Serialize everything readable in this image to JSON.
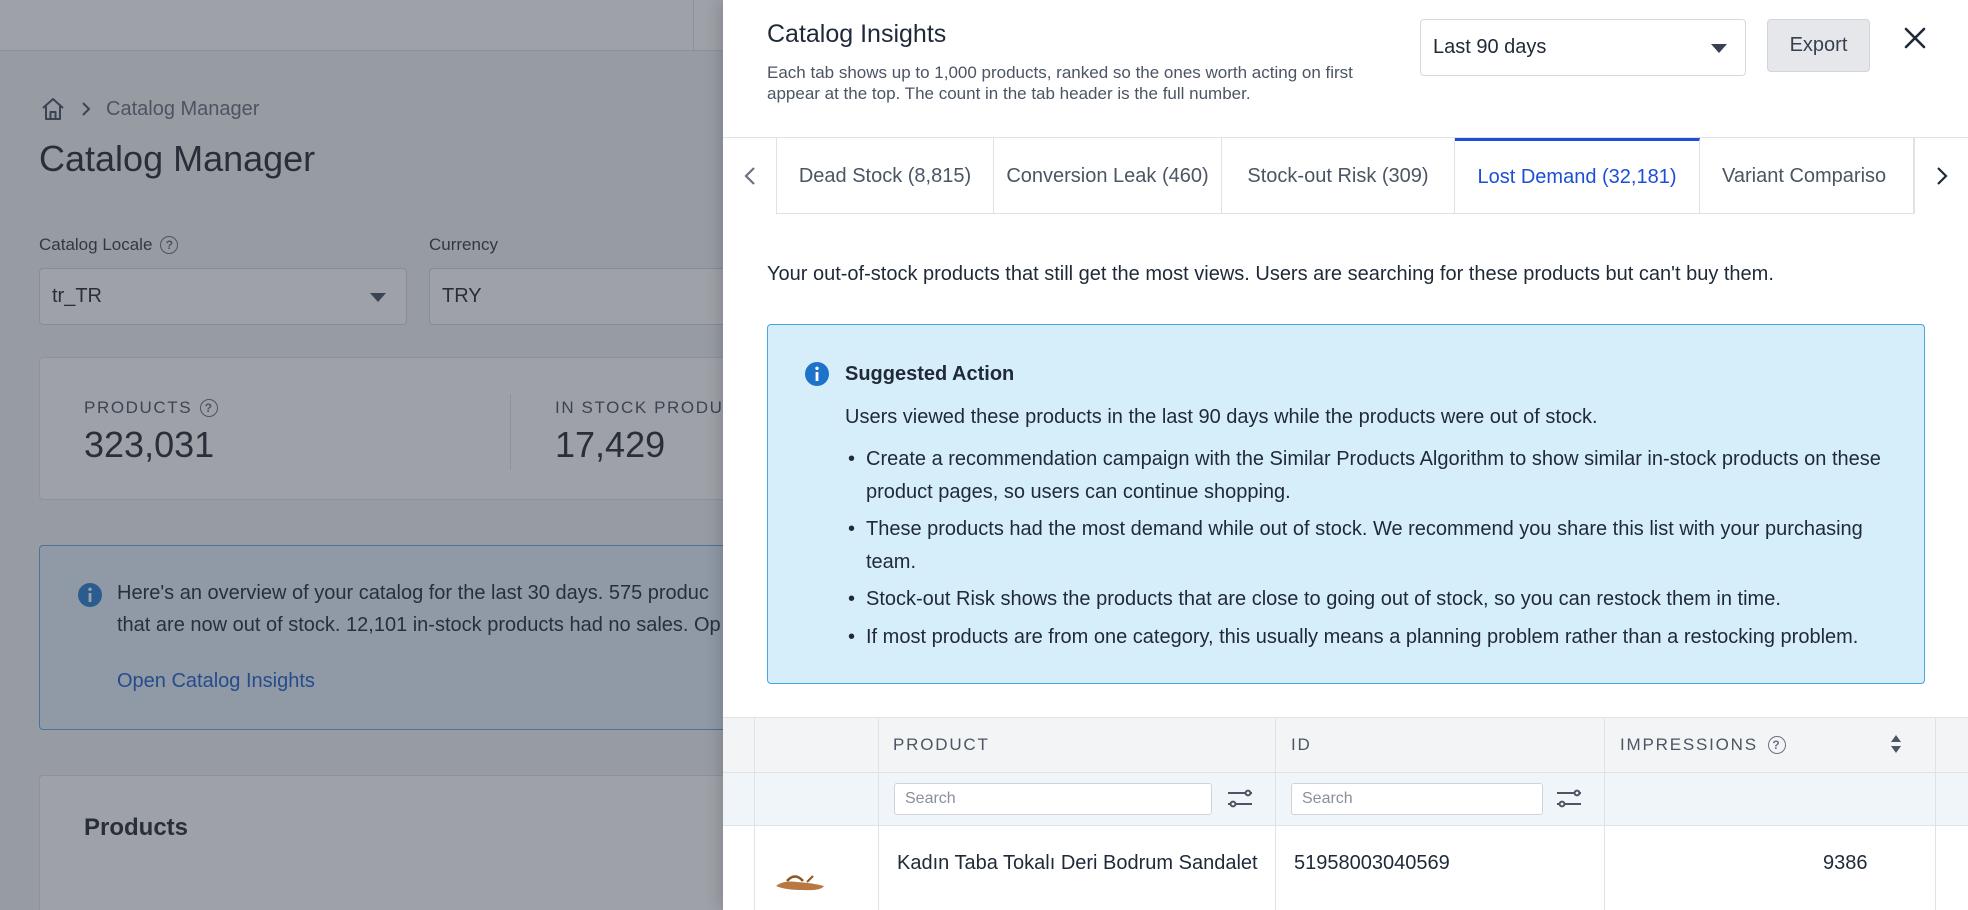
{
  "background": {
    "breadcrumb": {
      "current": "Catalog Manager"
    },
    "page_title": "Catalog Manager",
    "locale": {
      "label": "Catalog Locale",
      "value": "tr_TR"
    },
    "currency": {
      "label": "Currency",
      "value": "TRY"
    },
    "stats": [
      {
        "label": "PRODUCTS",
        "value": "323,031"
      },
      {
        "label": "IN STOCK PRODU",
        "value": "17,429"
      }
    ],
    "info": {
      "line1": "Here's an overview of your catalog for the last 30 days. 575 produc",
      "line2": "that are now out of stock. 12,101 in-stock products had no sales. Op",
      "link": "Open Catalog Insights"
    },
    "products_title": "Products"
  },
  "drawer": {
    "title": "Catalog Insights",
    "subtitle": "Each tab shows up to 1,000 products, ranked so the ones worth acting on first appear at the top. The count in the tab header is the full number.",
    "range_select": "Last 90 days",
    "export_label": "Export",
    "tabs": [
      {
        "label": "Dead Stock (8,815)",
        "active": false
      },
      {
        "label": "Conversion Leak (460)",
        "active": false
      },
      {
        "label": "Stock-out Risk (309)",
        "active": false
      },
      {
        "label": "Lost Demand (32,181)",
        "active": true
      },
      {
        "label": "Variant Compariso",
        "active": false
      }
    ],
    "description": "Your out-of-stock products that still get the most views. Users are searching for these products but can't buy them.",
    "suggested_action": {
      "title": "Suggested Action",
      "lead": "Users viewed these products in the last 90 days while the products were out of stock.",
      "bullets": [
        "Create a recommendation campaign with the Similar Products Algorithm to show similar in-stock products on these product pages, so users can continue shopping.",
        "These products had the most demand while out of stock. We recommend you share this list with your purchasing team.",
        "Stock-out Risk shows the products that are close to going out of stock, so you can restock them in time.",
        "If most products are from one category, this usually means a planning problem rather than a restocking problem."
      ]
    },
    "table": {
      "columns": {
        "product": "PRODUCT",
        "id": "ID",
        "impressions": "IMPRESSIONS"
      },
      "search_placeholder": "Search",
      "rows": [
        {
          "product": "Kadın Taba Tokalı Deri Bodrum Sandalet",
          "id": "51958003040569",
          "impressions": "9386"
        }
      ]
    }
  },
  "colors": {
    "accent": "#1d4ed8",
    "info_bg": "#d6eefa",
    "info_border": "#4aa3de",
    "overlay": "rgba(40,48,62,0.45)"
  },
  "icons": [
    "home-icon",
    "chevron-right-icon",
    "help-icon",
    "info-icon",
    "close-icon",
    "chevron-left-icon",
    "sort-icon",
    "filter-icon"
  ]
}
